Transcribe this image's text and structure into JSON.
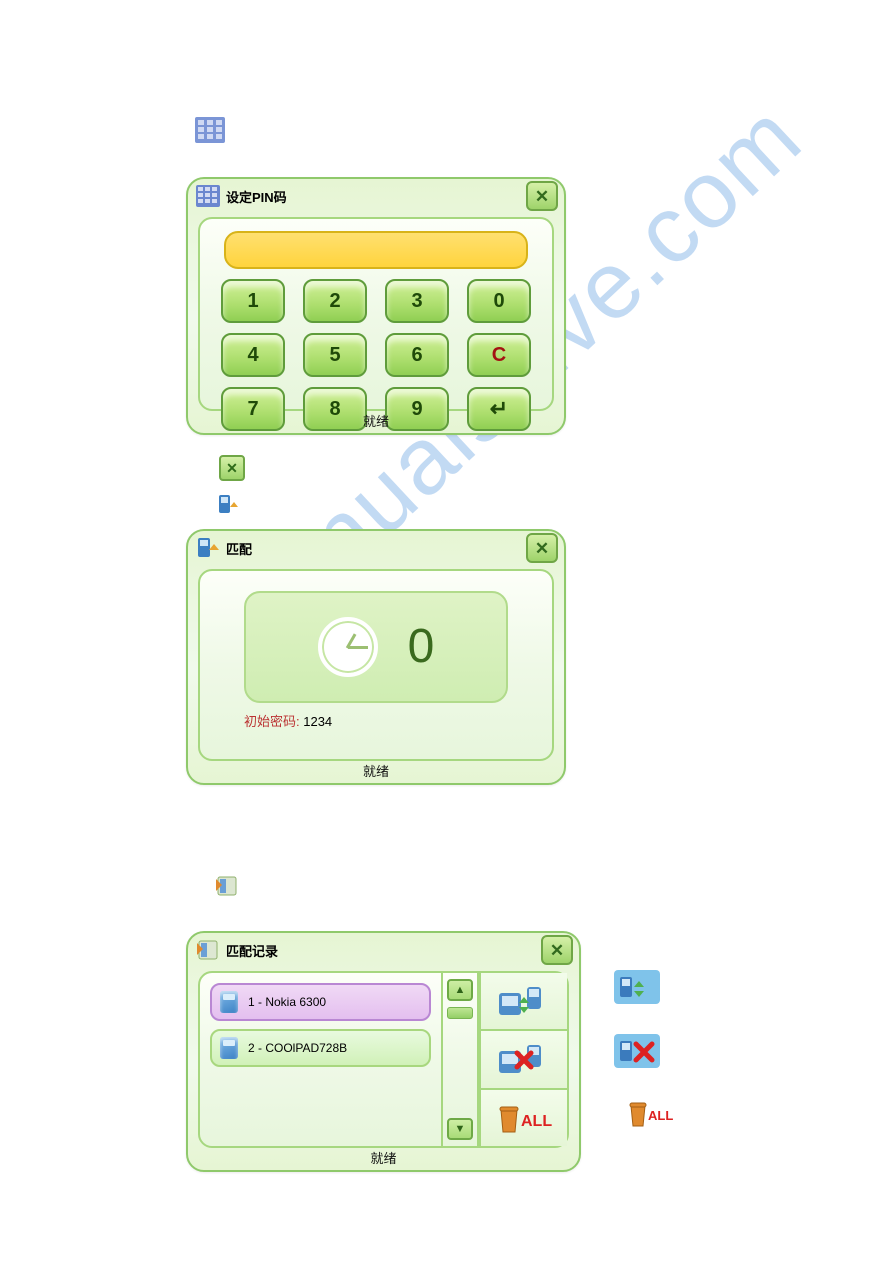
{
  "watermark": "manualshive.com",
  "pin_dialog": {
    "title": "设定PIN码",
    "status": "就绪",
    "keys_row1": [
      "1",
      "2",
      "3",
      "0"
    ],
    "keys_row2": [
      "4",
      "5",
      "6",
      "C"
    ],
    "keys_row3": [
      "7",
      "8",
      "9",
      "↵"
    ]
  },
  "pair_dialog": {
    "title": "匹配",
    "status": "就绪",
    "count": "0",
    "hint_label": "初始密码: ",
    "hint_value": "1234"
  },
  "record_dialog": {
    "title": "匹配记录",
    "status": "就绪",
    "devices": [
      {
        "label": "1 - Nokia 6300",
        "selected": true
      },
      {
        "label": "2 - COOlPAD728B",
        "selected": false
      }
    ],
    "delete_all_label": "ALL"
  },
  "legend": {
    "delete_all_label": "ALL"
  }
}
